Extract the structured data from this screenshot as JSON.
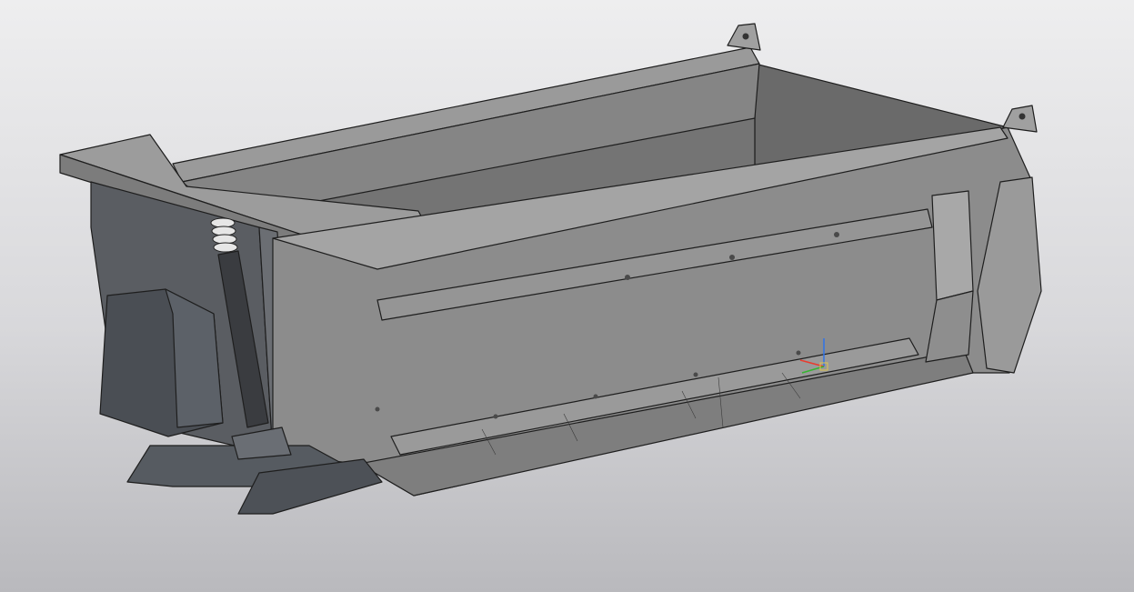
{
  "scene": {
    "type": "cad-3d-viewport",
    "object": "dump-truck-body",
    "background_top": "#eeeeef",
    "background_bottom": "#b9b9bd",
    "body_color": "#8c8c8c",
    "interior_color": "#6e6e6e",
    "dark_panel_color": "#50545a",
    "cylinder_color": "#3a3c40"
  },
  "triad": {
    "x_axis_color": "#e83b2e",
    "y_axis_color": "#35b531",
    "z_axis_color": "#2f73e8"
  }
}
